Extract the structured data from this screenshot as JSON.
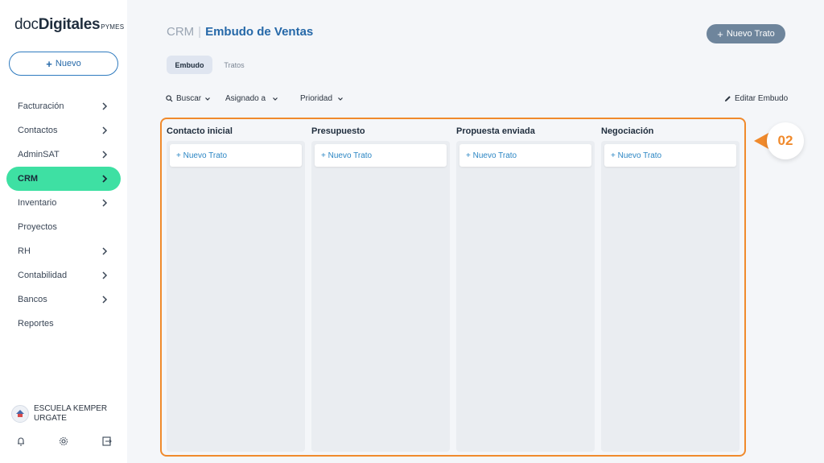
{
  "logo": {
    "doc": "doc",
    "digitales": "Digitales",
    "pymes": "PYMES"
  },
  "sidebar": {
    "new_button": "Nuevo",
    "items": [
      {
        "label": "Facturación",
        "chevron": true
      },
      {
        "label": "Contactos",
        "chevron": true
      },
      {
        "label": "AdminSAT",
        "chevron": true
      },
      {
        "label": "CRM",
        "chevron": true,
        "active": true
      },
      {
        "label": "Inventario",
        "chevron": true
      },
      {
        "label": "Proyectos",
        "chevron": false
      },
      {
        "label": "RH",
        "chevron": true
      },
      {
        "label": "Contabilidad",
        "chevron": true
      },
      {
        "label": "Bancos",
        "chevron": true
      },
      {
        "label": "Reportes",
        "chevron": false
      }
    ],
    "org_name_line1": "ESCUELA KEMPER",
    "org_name_line2": "URGATE"
  },
  "header": {
    "module": "CRM",
    "separator": "|",
    "title": "Embudo de Ventas",
    "new_deal_button": "Nuevo Trato"
  },
  "tabs": [
    {
      "label": "Embudo",
      "active": true
    },
    {
      "label": "Tratos",
      "active": false
    }
  ],
  "filters": {
    "search": "Buscar",
    "assigned": "Asignado a",
    "priority": "Prioridad",
    "edit_funnel": "Editar Embudo"
  },
  "board": {
    "columns": [
      {
        "title": "Contacto inicial",
        "new_card": "+ Nuevo Trato"
      },
      {
        "title": "Presupuesto",
        "new_card": "+ Nuevo Trato"
      },
      {
        "title": "Propuesta enviada",
        "new_card": "+ Nuevo Trato"
      },
      {
        "title": "Negociación",
        "new_card": "+ Nuevo Trato"
      }
    ]
  },
  "callout": {
    "label": "02"
  },
  "colors": {
    "accent": "#2568a8",
    "active_nav": "#3ee0a3",
    "highlight": "#f08a2c",
    "primary_button": "#6e859c"
  }
}
